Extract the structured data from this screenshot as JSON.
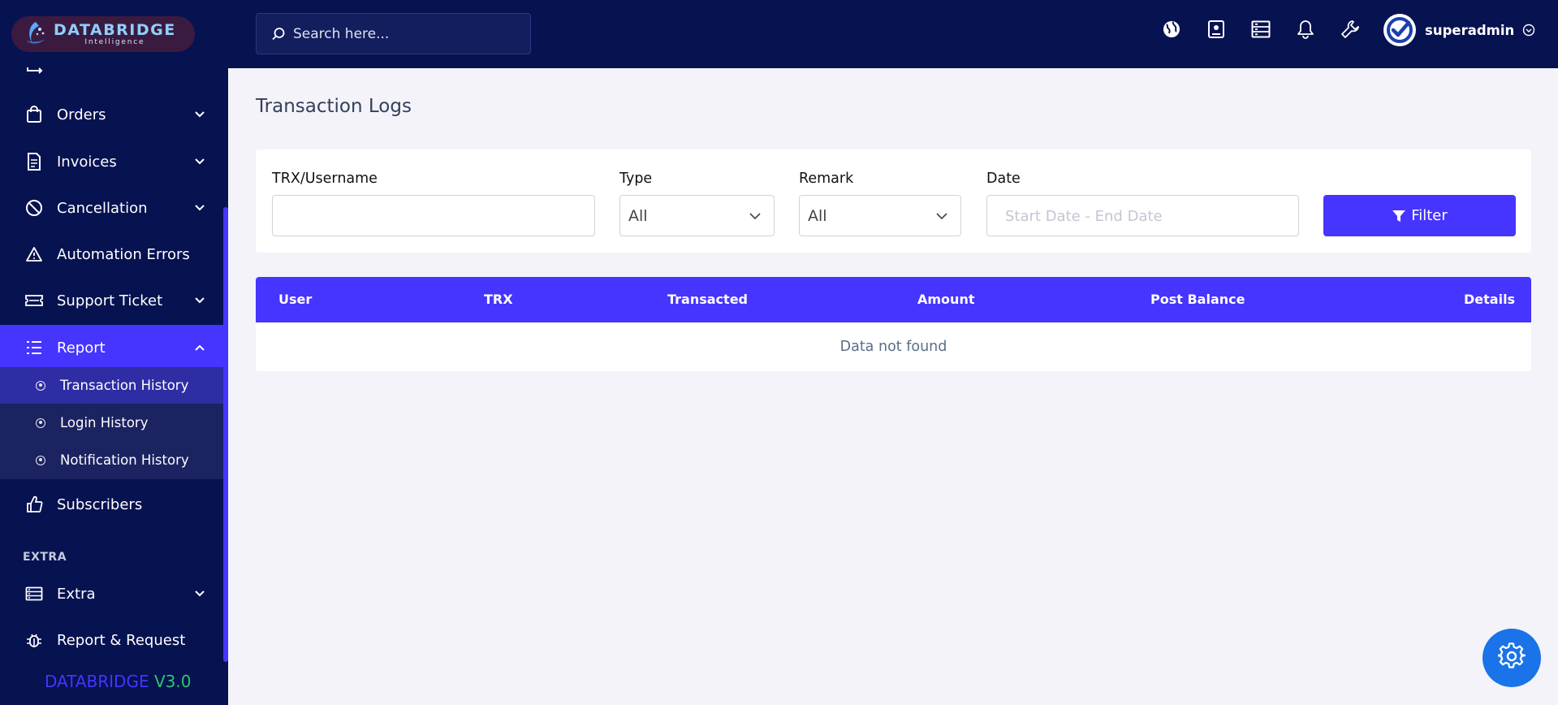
{
  "brand": {
    "name": "DATABRIDGE",
    "tagline": "Intelligence"
  },
  "sidebar": {
    "items": [
      {
        "label": "Orders",
        "icon": "shopping-bag-icon"
      },
      {
        "label": "Invoices",
        "icon": "invoice-icon"
      },
      {
        "label": "Cancellation",
        "icon": "ban-icon"
      },
      {
        "label": "Automation Errors",
        "icon": "warning-icon"
      },
      {
        "label": "Support Ticket",
        "icon": "ticket-icon"
      },
      {
        "label": "Report",
        "icon": "list-icon"
      },
      {
        "label": "Subscribers",
        "icon": "thumbs-up-icon"
      }
    ],
    "report_sub": [
      {
        "label": "Transaction History"
      },
      {
        "label": "Login History"
      },
      {
        "label": "Notification History"
      }
    ],
    "section_extra": "EXTRA",
    "extra_items": [
      {
        "label": "Extra",
        "icon": "server-icon"
      },
      {
        "label": "Report & Request",
        "icon": "bug-icon"
      }
    ],
    "version_brand": "DATABRIDGE",
    "version_number": "V3.0"
  },
  "header": {
    "search_placeholder": "Search here...",
    "username": "superadmin"
  },
  "main": {
    "title": "Transaction Logs",
    "filters": {
      "trx_label": "TRX/Username",
      "trx_value": "",
      "type_label": "Type",
      "type_value": "All",
      "remark_label": "Remark",
      "remark_value": "All",
      "date_label": "Date",
      "date_placeholder": "Start Date - End Date",
      "filter_button": "Filter"
    },
    "table": {
      "columns": [
        "User",
        "TRX",
        "Transacted",
        "Amount",
        "Post Balance",
        "Details"
      ],
      "empty_text": "Data not found"
    }
  },
  "colors": {
    "sidebar_bg": "#071251",
    "accent": "#4634ff",
    "version_green": "#28c76f",
    "fab": "#1a73e8"
  }
}
